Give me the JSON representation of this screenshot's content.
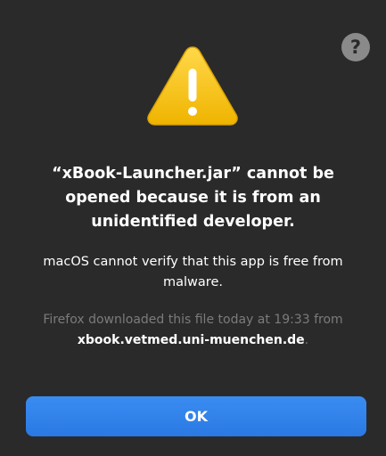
{
  "dialog": {
    "help_icon": "question-mark",
    "warning_icon": "warning-triangle",
    "title": "“xBook-Launcher.jar” cannot be opened because it is from an unidentified developer.",
    "message": "macOS cannot verify that this app is free from malware.",
    "info_prefix": "Firefox downloaded this file today at 19:33 from ",
    "info_source": "xbook.vetmed.uni-muenchen.de",
    "info_suffix": ".",
    "ok_label": "OK"
  },
  "colors": {
    "background": "#2a2a2a",
    "accent": "#2f80ed",
    "warning": "#f5c400",
    "muted_text": "#7b7b7b"
  }
}
